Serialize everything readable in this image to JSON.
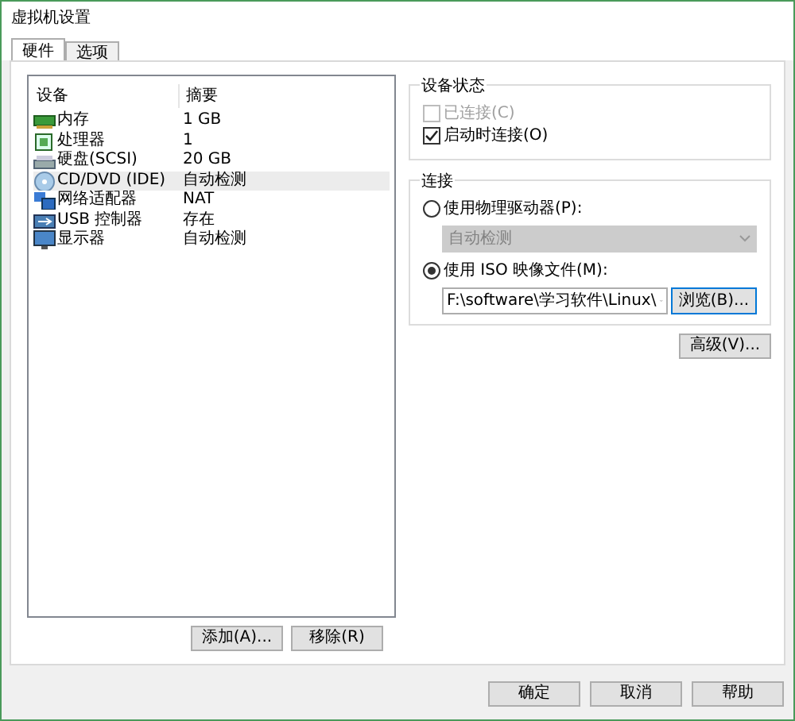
{
  "window": {
    "title": "虚拟机设置"
  },
  "tabs": [
    {
      "label": "硬件",
      "selected": true
    },
    {
      "label": "选项",
      "selected": false
    }
  ],
  "device_list": {
    "columns": [
      "设备",
      "摘要"
    ],
    "rows": [
      {
        "kind": "memory",
        "device": "内存",
        "summary": "1 GB",
        "selected": false
      },
      {
        "kind": "cpu",
        "device": "处理器",
        "summary": "1",
        "selected": false
      },
      {
        "kind": "disk",
        "device": "硬盘(SCSI)",
        "summary": "20 GB",
        "selected": false
      },
      {
        "kind": "cd",
        "device": "CD/DVD (IDE)",
        "summary": "自动检测",
        "selected": true
      },
      {
        "kind": "network",
        "device": "网络适配器",
        "summary": "NAT",
        "selected": false
      },
      {
        "kind": "usb",
        "device": "USB 控制器",
        "summary": "存在",
        "selected": false
      },
      {
        "kind": "display",
        "device": "显示器",
        "summary": "自动检测",
        "selected": false
      }
    ]
  },
  "list_buttons": [
    "添加(A)...",
    "移除(R)"
  ],
  "device_status": {
    "title": "设备状态",
    "options": [
      {
        "label": "已连接(C)",
        "checked": false,
        "disabled": true
      },
      {
        "label": "启动时连接(O)",
        "checked": true,
        "disabled": false
      }
    ]
  },
  "connection": {
    "title": "连接",
    "options": [
      {
        "label": "使用物理驱动器(P):",
        "selected": false,
        "value": "自动检测"
      },
      {
        "label": "使用 ISO 映像文件(M):",
        "selected": true,
        "value": "F:\\software\\学习软件\\Linux\\",
        "button": "浏览(B)..."
      }
    ]
  },
  "advanced_button": "高级(V)...",
  "dialog_buttons": [
    "确定",
    "取消",
    "帮助"
  ]
}
